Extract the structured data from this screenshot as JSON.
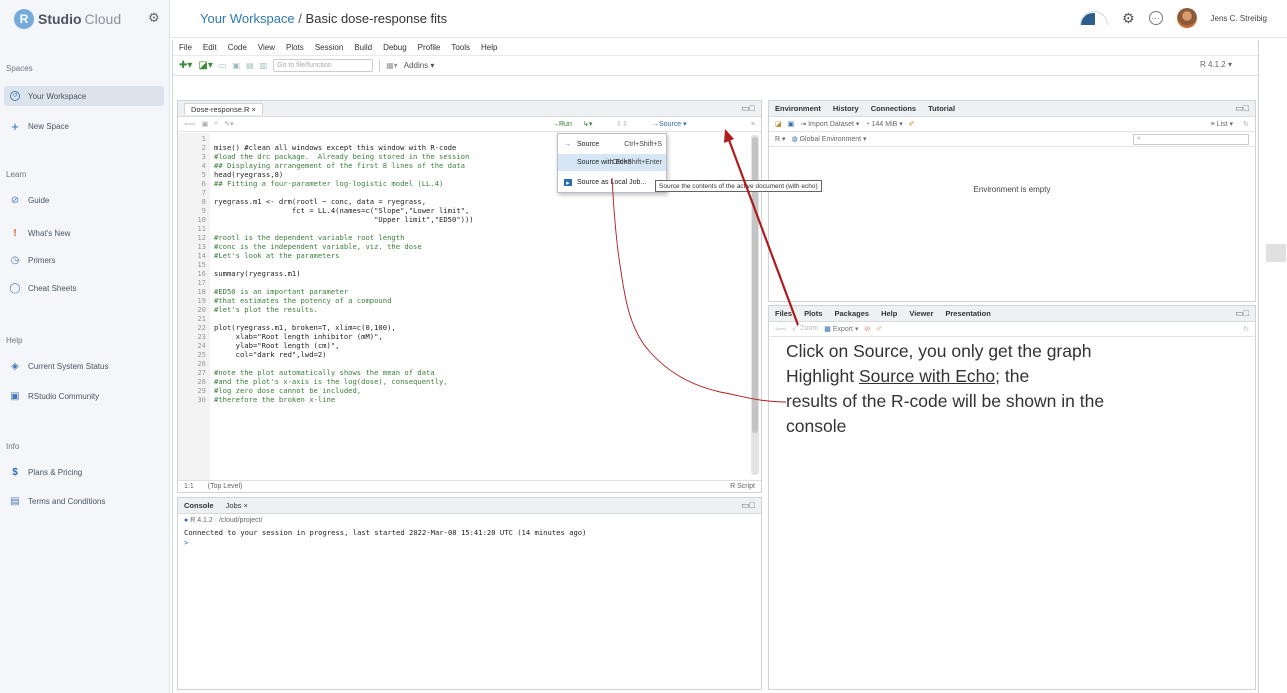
{
  "sidebar": {
    "brand_logo": "R",
    "brand_studio": "Studio",
    "brand_cloud": "Cloud",
    "sections": {
      "spaces": "Spaces",
      "learn": "Learn",
      "help": "Help",
      "info": "Info"
    },
    "items": [
      {
        "label": "Your Workspace",
        "icon": "workspace-icon"
      },
      {
        "label": "New Space",
        "icon": "plus-icon"
      },
      {
        "label": "Guide",
        "icon": "compass-icon"
      },
      {
        "label": "What's New",
        "icon": "exclamation-icon"
      },
      {
        "label": "Primers",
        "icon": "timer-icon"
      },
      {
        "label": "Cheat Sheets",
        "icon": "sheet-icon"
      },
      {
        "label": "Current System Status",
        "icon": "status-icon"
      },
      {
        "label": "RStudio Community",
        "icon": "community-icon"
      },
      {
        "label": "Plans & Pricing",
        "icon": "dollar-icon"
      },
      {
        "label": "Terms and Conditions",
        "icon": "document-icon"
      }
    ]
  },
  "header": {
    "workspace": "Your Workspace",
    "separator": "/",
    "project": "Basic dose-response fits",
    "user_name": "Jens C. Streibig"
  },
  "ide": {
    "menu": [
      "File",
      "Edit",
      "Code",
      "View",
      "Plots",
      "Session",
      "Build",
      "Debug",
      "Profile",
      "Tools",
      "Help"
    ],
    "goto_placeholder": "Go to file/function",
    "addins_label": "Addins",
    "r_version": "R 4.1.2",
    "editor": {
      "file_tab": "Dose-response.R",
      "run_label": "Run",
      "source_label": "Source",
      "status_pos": "1:1",
      "status_scope": "(Top Level)",
      "status_type": "R Script",
      "lines": [
        {
          "n": "1",
          "text": "",
          "comment": false
        },
        {
          "n": "2",
          "text": "mise() #clean all windows except this window with R-code",
          "comment": false
        },
        {
          "n": "3",
          "text": "#load the drc package.  Already being stored in the session",
          "comment": true
        },
        {
          "n": "4",
          "text": "## Displaying arrangement of the first 8 lines of the data",
          "comment": true
        },
        {
          "n": "5",
          "text": "head(ryegrass,8)",
          "comment": false
        },
        {
          "n": "6",
          "text": "## Fitting a four-parameter log-logistic model (LL.4)",
          "comment": true
        },
        {
          "n": "7",
          "text": "",
          "comment": false
        },
        {
          "n": "8",
          "text": "ryegrass.m1 <- drm(rootl ~ conc, data = ryegrass,",
          "comment": false
        },
        {
          "n": "9",
          "text": "                  fct = LL.4(names=c(\"Slope\",\"Lower limit\",",
          "comment": false
        },
        {
          "n": "10",
          "text": "                                     \"Upper limit\",\"ED50\")))",
          "comment": false
        },
        {
          "n": "11",
          "text": "",
          "comment": false
        },
        {
          "n": "12",
          "text": "#rootl is the dependent variable root length",
          "comment": true
        },
        {
          "n": "13",
          "text": "#conc is the independent variable, viz. the dose",
          "comment": true
        },
        {
          "n": "14",
          "text": "#Let's look at the parameters",
          "comment": true
        },
        {
          "n": "15",
          "text": "",
          "comment": false
        },
        {
          "n": "16",
          "text": "summary(ryegrass.m1)",
          "comment": false
        },
        {
          "n": "17",
          "text": "",
          "comment": false
        },
        {
          "n": "18",
          "text": "#ED50 is an important parameter",
          "comment": true
        },
        {
          "n": "19",
          "text": "#that estimates the potency of a compound",
          "comment": true
        },
        {
          "n": "20",
          "text": "#let's plot the results.",
          "comment": true
        },
        {
          "n": "21",
          "text": "",
          "comment": false
        },
        {
          "n": "22",
          "text": "plot(ryegrass.m1, broken=T, xlim=c(0,100),",
          "comment": false
        },
        {
          "n": "23",
          "text": "     xlab=\"Root length inhibitor (mM)\",",
          "comment": false
        },
        {
          "n": "24",
          "text": "     ylab=\"Root length (cm)\",",
          "comment": false
        },
        {
          "n": "25",
          "text": "     col=\"dark red\",lwd=2)",
          "comment": false
        },
        {
          "n": "26",
          "text": "",
          "comment": false
        },
        {
          "n": "27",
          "text": "#note the plot automatically shows the mean of data",
          "comment": true
        },
        {
          "n": "28",
          "text": "#and the plot's x-axis is the log(dose), consequently,",
          "comment": true
        },
        {
          "n": "29",
          "text": "#log zero dose cannot be included,",
          "comment": true
        },
        {
          "n": "30",
          "text": "#therefore the broken x-line",
          "comment": true
        }
      ]
    },
    "source_menu": {
      "items": [
        {
          "label": "Source",
          "shortcut": "Ctrl+Shift+S"
        },
        {
          "label": "Source with Echo",
          "shortcut": "Ctrl+Shift+Enter"
        },
        {
          "label": "Source as Local Job...",
          "shortcut": ""
        }
      ],
      "tooltip": "Source the contents of the active document (with echo)"
    },
    "console": {
      "tabs": [
        "Console",
        "Jobs"
      ],
      "path": "R 4.1.2 · /cloud/project/",
      "message": "Connected to your session in progress, last started 2022-Mar-08 15:41:20 UTC (14 minutes ago)",
      "prompt": ">"
    },
    "env_pane": {
      "tabs": [
        "Environment",
        "History",
        "Connections",
        "Tutorial"
      ],
      "import_label": "Import Dataset",
      "memory_label": "144 MiB",
      "list_label": "List",
      "r_label": "R",
      "global_env": "Global Environment",
      "empty_message": "Environment is empty"
    },
    "files_pane": {
      "tabs": [
        "Files",
        "Plots",
        "Packages",
        "Help",
        "Viewer",
        "Presentation"
      ],
      "zoom_label": "Zoom",
      "export_label": "Export"
    }
  },
  "annotation": {
    "line1": "Click on Source, you only get the graph",
    "line2_prefix": "Highlight ",
    "line2_underlined": "Source with Echo;",
    "line2_suffix": "  the",
    "line3": "results of the R-code will be shown in the",
    "line4": "console",
    "arrow_color": "#b01c1c"
  }
}
